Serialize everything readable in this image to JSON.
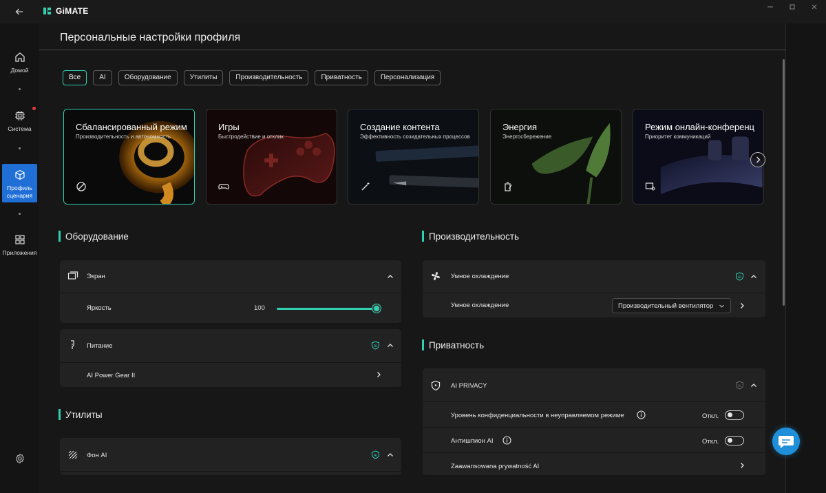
{
  "app": {
    "name": "GiMATE"
  },
  "colors": {
    "accent": "#2fd1b0",
    "active_nav": "#1f6fd6",
    "notification": "#e23b3b",
    "chat": "#1e8fd8"
  },
  "sidebar": {
    "items": [
      {
        "label": "Домой",
        "icon": "home-icon"
      },
      {
        "label": "Система",
        "icon": "chip-icon"
      },
      {
        "label": "Профиль сценария",
        "icon": "cube-icon"
      },
      {
        "label": "Приложения",
        "icon": "apps-grid-icon"
      }
    ]
  },
  "page": {
    "title": "Персональные настройки профиля"
  },
  "filters": [
    "Все",
    "AI",
    "Оборудование",
    "Утилиты",
    "Производительность",
    "Приватность",
    "Персонализация"
  ],
  "scenarios": [
    {
      "title": "Сбалансированный режим",
      "subtitle": "Производительность и автономность",
      "icon": "balance-icon"
    },
    {
      "title": "Игры",
      "subtitle": "Быстродействие и отклик",
      "icon": "gamepad-icon"
    },
    {
      "title": "Создание контента",
      "subtitle": "Эффективность созидательных процессов",
      "icon": "magic-wand-icon"
    },
    {
      "title": "Энергия",
      "subtitle": "Энергосбережение",
      "icon": "battery-leaf-icon"
    },
    {
      "title": "Режим онлайн-конференц",
      "subtitle": "Приоритет коммуникаций",
      "icon": "conference-icon"
    }
  ],
  "hardware": {
    "title": "Оборудование",
    "display": {
      "label": "Экран",
      "brightness_label": "Яркость",
      "brightness_value": "100",
      "brightness_fraction": 1.0
    },
    "power": {
      "label": "Питание",
      "item": "AI Power Gear II"
    }
  },
  "utilities": {
    "title": "Утилиты",
    "background_ai": {
      "label": "Фон AI"
    }
  },
  "performance": {
    "title": "Производительность",
    "smart_cooling": {
      "label": "Умное охлаждение",
      "item_label": "Умное охлаждение",
      "selected": "Производительный вентилятор"
    }
  },
  "privacy": {
    "title": "Приватность",
    "ai_privacy": {
      "label": "AI PRIVACY",
      "rows": [
        {
          "label": "Уровень конфиденциальности в неуправляемом режиме",
          "state": "Откл."
        },
        {
          "label": "Антишпион AI",
          "state": "Откл."
        }
      ],
      "advanced": "Zaawansowana prywatność AI"
    }
  }
}
